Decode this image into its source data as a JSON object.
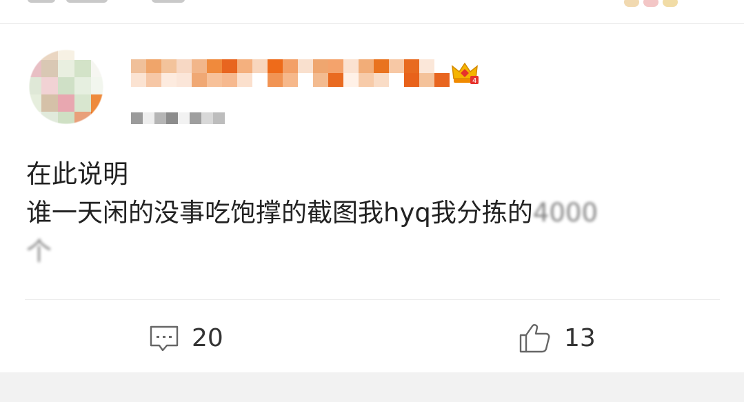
{
  "post": {
    "body_line_1": "在此说明",
    "body_line_2": "谁一天闲的没事吃饱撑的截图我hyq我分拣的",
    "body_line_2_obscured_tail": "4000",
    "body_line_3_obscured": "个"
  },
  "actions": {
    "comment_count": "20",
    "like_count": "13"
  },
  "icons": {
    "comment": "comment-bubble-icon",
    "like": "thumbs-up-icon",
    "vip": "vip-crown-badge-icon"
  },
  "colors": {
    "text": "#222222",
    "count_text": "#333333",
    "icon_stroke": "#666666",
    "divider": "#ececec",
    "background": "#ffffff",
    "bottom_band": "#f2f2f2"
  }
}
